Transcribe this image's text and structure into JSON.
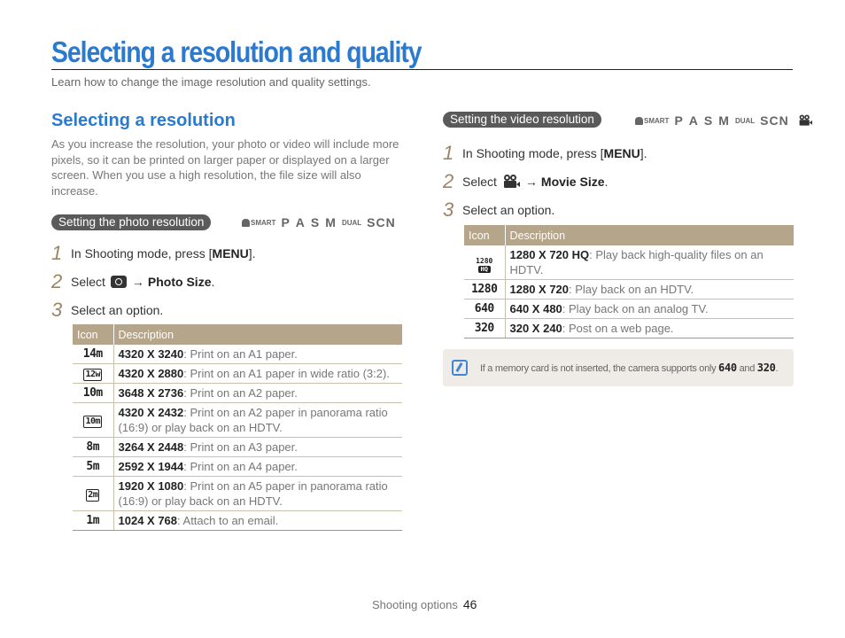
{
  "header": {
    "title": "Selecting a resolution and quality",
    "subtitle": "Learn how to change the image resolution and quality settings."
  },
  "left": {
    "section_heading": "Selecting a resolution",
    "intro": "As you increase the resolution, your photo or video will include more pixels, so it can be printed on larger paper or displayed on a larger screen. When you use a high resolution, the file size will also increase.",
    "photo_pill": "Setting the photo resolution",
    "modes": {
      "smart": "SMART",
      "p": "P",
      "a": "A",
      "s": "S",
      "m": "M",
      "dual": "DUAL",
      "scn": "SCN"
    },
    "steps": [
      {
        "num": "1",
        "before": "In Shooting mode, press [",
        "key": "MENU",
        "after": "]."
      },
      {
        "num": "2",
        "before": "Select",
        "icon": "camera-icon",
        "arrow": "→",
        "bold": "Photo Size",
        "after": "."
      },
      {
        "num": "3",
        "text": "Select an option."
      }
    ],
    "table": {
      "headers": [
        "Icon",
        "Description"
      ],
      "rows": [
        {
          "icon": "14m",
          "res": "4320 X 3240",
          "desc": ": Print on an A1 paper."
        },
        {
          "icon": "12w",
          "res": "4320 X 2880",
          "desc": ": Print on an A1 paper in wide ratio (3:2)."
        },
        {
          "icon": "10m",
          "res": "3648 X 2736",
          "desc": ": Print on an A2 paper."
        },
        {
          "icon": "10m",
          "res": "4320 X 2432",
          "desc": ": Print on an A2 paper in panorama ratio (16:9) or play back on an HDTV."
        },
        {
          "icon": "8m",
          "res": "3264 X 2448",
          "desc": ": Print on an A3 paper."
        },
        {
          "icon": "5m",
          "res": "2592 X 1944",
          "desc": ": Print on an A4 paper."
        },
        {
          "icon": "2m",
          "res": "1920 X 1080",
          "desc": ": Print on an A5 paper in panorama ratio (16:9) or play back on an HDTV."
        },
        {
          "icon": "1m",
          "res": "1024 X 768",
          "desc": ": Attach to an email."
        }
      ]
    }
  },
  "right": {
    "video_pill": "Setting the video resolution",
    "modes": {
      "smart": "SMART",
      "p": "P",
      "a": "A",
      "s": "S",
      "m": "M",
      "dual": "DUAL",
      "scn": "SCN"
    },
    "steps": [
      {
        "num": "1",
        "before": "In Shooting mode, press [",
        "key": "MENU",
        "after": "]."
      },
      {
        "num": "2",
        "before": "Select",
        "icon": "movie-icon",
        "arrow": "→",
        "bold": "Movie Size",
        "after": "."
      },
      {
        "num": "3",
        "text": "Select an option."
      }
    ],
    "table": {
      "headers": [
        "Icon",
        "Description"
      ],
      "rows": [
        {
          "icon": "1280",
          "icon_sub": "HQ",
          "res": "1280 X 720 HQ",
          "desc": ": Play back high-quality files on an HDTV."
        },
        {
          "icon": "1280",
          "res": "1280 X 720",
          "desc": ": Play back on an HDTV."
        },
        {
          "icon": "640",
          "res": "640 X 480",
          "desc": ": Play back on an analog TV."
        },
        {
          "icon": "320",
          "res": "320 X 240",
          "desc": ": Post on a web page."
        }
      ]
    },
    "note": {
      "before": "If a memory card is not inserted, the camera supports only ",
      "icon1": "640",
      "middle": " and ",
      "icon2": "320",
      "after": "."
    }
  },
  "footer": {
    "section": "Shooting options",
    "page": "46"
  },
  "colors": {
    "accent": "#2a7ad0",
    "table_header": "#b5a58a",
    "step_number": "#9c8466",
    "pill": "#5a5a5a",
    "note_bg": "#efebe6"
  }
}
